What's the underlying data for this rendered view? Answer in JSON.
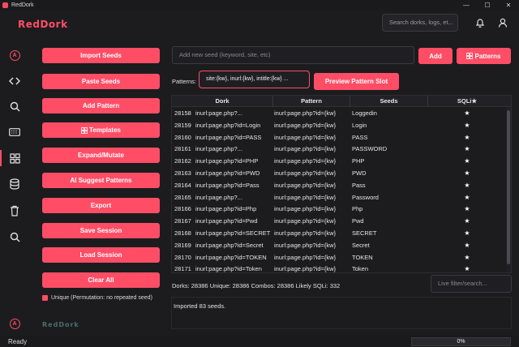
{
  "window": {
    "title": "RedDork",
    "minimize": "—",
    "maximize": "☐",
    "close": "✕"
  },
  "header": {
    "brand": "RedDork",
    "search_placeholder": "Search dorks, logs, et...",
    "bell_icon": "bell-icon",
    "user_icon": "user-icon"
  },
  "sidebar": {
    "logo_letter": "A",
    "items": [
      {
        "icon": "code-icon"
      },
      {
        "icon": "search-icon"
      },
      {
        "icon": "keyboard-icon"
      },
      {
        "icon": "grid-icon",
        "active": true
      },
      {
        "icon": "database-icon"
      },
      {
        "icon": "trash-icon"
      },
      {
        "icon": "search-icon"
      }
    ]
  },
  "actions": {
    "import_seeds": "Import Seeds",
    "paste_seeds": "Paste Seeds",
    "add_pattern": "Add Pattern",
    "templates": "Templates",
    "expand_mutate": "Expand/Mutate",
    "ai_suggest": "AI Suggest Patterns",
    "export": "Export",
    "save_session": "Save Session",
    "load_session": "Load Session",
    "clear_all": "Clear All",
    "unique_label": "Unique (Permutation: no repeated seed)"
  },
  "footer_logo": "RedDork",
  "seed": {
    "placeholder": "Add new seed (keyword, site, etc)",
    "add_label": "Add",
    "patterns_label": "Patterns"
  },
  "patterns": {
    "label": "Patterns:",
    "value": "site:{kw}, inurl:{kw}, intitle:{kw} ...",
    "preview_label": "Preview Pattern Slot"
  },
  "table": {
    "headers": [
      "Dork",
      "Pattern",
      "Seeds",
      "SQLi★"
    ],
    "rows": [
      {
        "id": "28158",
        "dork": "inurl:page.php?...",
        "pattern": "inurl:page.php?id={kw}",
        "seed": "Loggedin",
        "sqli": "★"
      },
      {
        "id": "28159",
        "dork": "inurl:page.php?id=Login",
        "pattern": "inurl:page.php?id={kw}",
        "seed": "Login",
        "sqli": "★"
      },
      {
        "id": "28160",
        "dork": "inurl:page.php?id=PASS",
        "pattern": "inurl:page.php?id={kw}",
        "seed": "PASS",
        "sqli": "★"
      },
      {
        "id": "28161",
        "dork": "inurl:page.php?...",
        "pattern": "inurl:page.php?id={kw}",
        "seed": "PASSWORD",
        "sqli": "★"
      },
      {
        "id": "28162",
        "dork": "inurl:page.php?id=PHP",
        "pattern": "inurl:page.php?id={kw}",
        "seed": "PHP",
        "sqli": "★"
      },
      {
        "id": "28163",
        "dork": "inurl:page.php?id=PWD",
        "pattern": "inurl:page.php?id={kw}",
        "seed": "PWD",
        "sqli": "★"
      },
      {
        "id": "28164",
        "dork": "inurl:page.php?id=Pass",
        "pattern": "inurl:page.php?id={kw}",
        "seed": "Pass",
        "sqli": "★"
      },
      {
        "id": "28165",
        "dork": "inurl:page.php?...",
        "pattern": "inurl:page.php?id={kw}",
        "seed": "Password",
        "sqli": "★"
      },
      {
        "id": "28166",
        "dork": "inurl:page.php?id=Php",
        "pattern": "inurl:page.php?id={kw}",
        "seed": "Php",
        "sqli": "★"
      },
      {
        "id": "28167",
        "dork": "inurl:page.php?id=Pwd",
        "pattern": "inurl:page.php?id={kw}",
        "seed": "Pwd",
        "sqli": "★"
      },
      {
        "id": "28168",
        "dork": "inurl:page.php?id=SECRET",
        "pattern": "inurl:page.php?id={kw}",
        "seed": "SECRET",
        "sqli": "★"
      },
      {
        "id": "28169",
        "dork": "inurl:page.php?id=Secret",
        "pattern": "inurl:page.php?id={kw}",
        "seed": "Secret",
        "sqli": "★"
      },
      {
        "id": "28170",
        "dork": "inurl:page.php?id=TOKEN",
        "pattern": "inurl:page.php?id={kw}",
        "seed": "TOKEN",
        "sqli": "★"
      },
      {
        "id": "28171",
        "dork": "inurl:page.php?id=Token",
        "pattern": "inurl:page.php?id={kw}",
        "seed": "Token",
        "sqli": "★"
      }
    ]
  },
  "stats": "Dorks: 28386  Unique: 28386  Combos: 28386  Likely SQLi: 332",
  "filter_placeholder": "Live filter/search...",
  "log": "Imported 83 seeds.",
  "status": {
    "text": "Ready",
    "progress_percent": 0,
    "progress_label": "0%"
  },
  "colors": {
    "accent": "#ff4d66",
    "background": "#1c1c1f"
  }
}
